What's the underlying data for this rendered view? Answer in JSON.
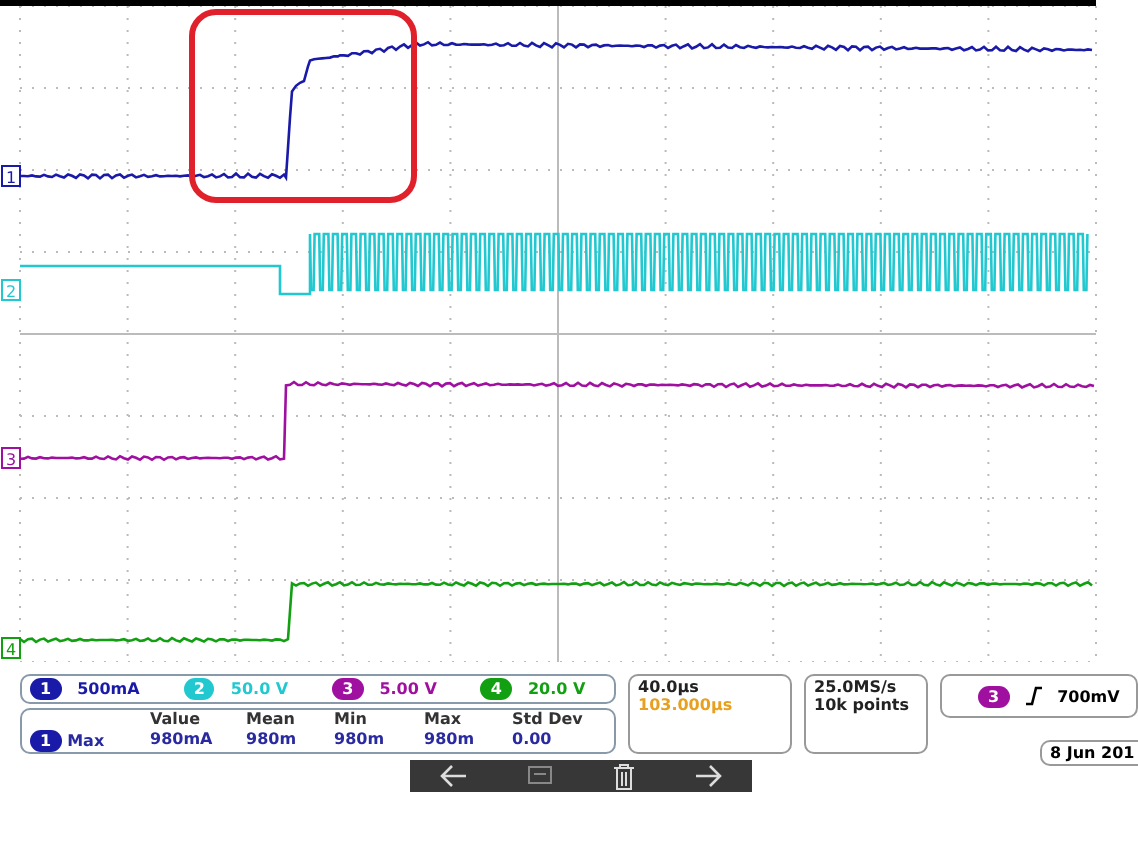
{
  "channels": [
    {
      "label": "1",
      "marker_label": "1",
      "color": "#1a1aa8",
      "scale": "500mA"
    },
    {
      "label": "2",
      "marker_label": "2",
      "color": "#22c8d0",
      "scale": "50.0 V"
    },
    {
      "label": "3",
      "marker_label": "3",
      "color": "#a010a0",
      "scale": "5.00 V"
    },
    {
      "label": "4",
      "marker_label": "4",
      "color": "#12a012",
      "scale": "20.0 V"
    }
  ],
  "measurement": {
    "columns": [
      "Value",
      "Mean",
      "Min",
      "Max",
      "Std Dev"
    ],
    "channel": "1",
    "name": "Max",
    "values": [
      "980mA",
      "980m",
      "980m",
      "980m",
      "0.00"
    ]
  },
  "timebase": {
    "scale": "40.0µs",
    "position": "103.000µs"
  },
  "acquisition": {
    "rate": "25.0MS/s",
    "length": "10k points"
  },
  "trigger": {
    "channel": "3",
    "level": "700mV"
  },
  "date": "8 Jun 201"
}
